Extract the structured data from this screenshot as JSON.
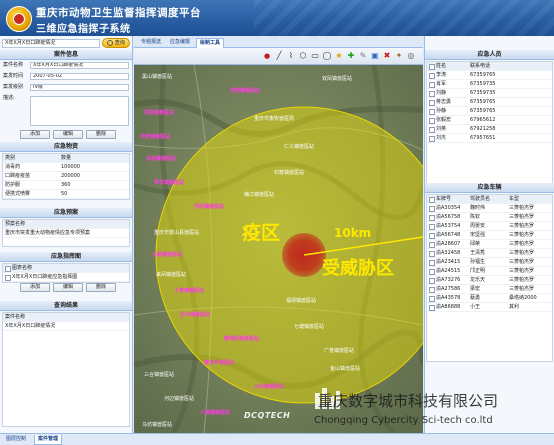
{
  "header": {
    "title_line1": "重庆市动物卫生监督指挥调度平台",
    "title_line2": "三维应急指挥子系统"
  },
  "left": {
    "search": {
      "value": "X年X月X日口蹄疫情况",
      "button": "查询"
    },
    "case_info": {
      "title": "案件信息",
      "fields": [
        {
          "label": "案件名称",
          "value": "X年X月X日口蹄疫情况"
        },
        {
          "label": "案发时间",
          "value": "2007-05-02"
        },
        {
          "label": "案发级别",
          "value": "IV级"
        },
        {
          "label": "描述:",
          "value": ""
        }
      ],
      "buttons": [
        "添加",
        "编辑",
        "删除"
      ]
    },
    "supplies": {
      "title": "应急物资",
      "headers": [
        "类别",
        "数量"
      ],
      "rows": [
        {
          "name": "消毒药",
          "qty": "100000"
        },
        {
          "name": "口蹄疫疫苗",
          "qty": "200000"
        },
        {
          "name": "防护服",
          "qty": "360"
        },
        {
          "name": "便携式喷雾",
          "qty": "50"
        }
      ]
    },
    "plan": {
      "title": "应急预案",
      "header": "预案名称",
      "rows": [
        "重庆市突发重大动物疫情应急专项预案"
      ]
    },
    "plan_map": {
      "title": "应急指挥图",
      "header": "图表名称",
      "rows": [
        "X年X月X日口蹄疫应急指挥图"
      ],
      "buttons": [
        "添加",
        "编辑",
        "删除"
      ]
    },
    "results": {
      "title": "查询结果",
      "header": "案件名称",
      "rows": [
        "X年X月X日口蹄疫情况"
      ]
    }
  },
  "center": {
    "tabs": [
      "专题报送",
      "应急编报",
      "绘制工具"
    ],
    "active_tab": 2,
    "map": {
      "label_epidemic": "疫区",
      "label_radius": "10km",
      "label_threat": "受威胁区",
      "places": [
        "黑山镇兽医站",
        "龙岗镇兽医站",
        "双凤镇兽医站",
        "花园镇兽医站",
        "重庆市畜牧兽医局",
        "天府镇兽医站",
        "仁义镇兽医站",
        "白庙镇兽医站",
        "石鞋镇兽医站",
        "青杠镇兽医站",
        "梅江镇兽医站",
        "丹阳镇兽医站",
        "重庆市璧山县兽医站",
        "大路镇兽医站",
        "来凤镇兽医站",
        "丁家镇兽医站",
        "福禄镇兽医站",
        "正兴镇兽医站",
        "七塘镇兽医站",
        "璧城街道兽医站",
        "广普镇兽医站",
        "健龙乡兽医站",
        "三合镇兽医站",
        "大兴镇兽医站",
        "河边镇兽医站",
        "八塘镇兽医站",
        "金山镇兽医站",
        "马坊镇兽医站"
      ]
    }
  },
  "right": {
    "personnel": {
      "title": "应急人员",
      "headers": [
        "姓名",
        "联系电话"
      ],
      "rows": [
        [
          "李涛",
          "67359765"
        ],
        [
          "肖军",
          "67359735"
        ],
        [
          "刘静",
          "67359735"
        ],
        [
          "蒋志勇",
          "67359765"
        ],
        [
          "孙静",
          "67359765"
        ],
        [
          "张毅宏",
          "67965612"
        ],
        [
          "刘英",
          "67921258"
        ],
        [
          "刘杰",
          "67957651"
        ]
      ]
    },
    "vehicles": {
      "title": "应急车辆",
      "headers": [
        "车牌号",
        "驾驶员名",
        "车型"
      ],
      "rows": [
        [
          "渝A30354",
          "魏时伟",
          "三菱帕杰罗"
        ],
        [
          "渝A56758",
          "陈钦",
          "三菱帕杰罗"
        ],
        [
          "渝A53754",
          "周晏安",
          "三菱帕杰罗"
        ],
        [
          "渝A56748",
          "宋坚强",
          "三菱帕杰罗"
        ],
        [
          "渝A28607",
          "邱荣",
          "三菱帕杰罗"
        ],
        [
          "渝A32458",
          "王清秀",
          "三菱帕杰罗"
        ],
        [
          "渝A23415",
          "孙福生",
          "三菱帕杰罗"
        ],
        [
          "渝A24515",
          "邝正明",
          "三菱帕杰罗"
        ],
        [
          "渝A73276",
          "龙乐天",
          "三菱帕杰罗"
        ],
        [
          "渝A27586",
          "梁宏",
          "三菱帕杰罗"
        ],
        [
          "渝A43578",
          "蔡勇",
          "桑塔纳2000"
        ],
        [
          "渝A86888",
          "小王",
          "其利"
        ]
      ]
    }
  },
  "status_tabs": [
    "图层控制",
    "案件管理"
  ],
  "active_status_tab": 1,
  "watermark": {
    "cn": "重庆数字城市科技有限公司",
    "en": "Chongqing Cybercity Sci-tech co.ltd",
    "logo": "DCQTECH"
  },
  "colors": {
    "header_blue": "#2a5fa3",
    "epidemic_red": "#d62a1c",
    "threat_yellow": "#f2e400",
    "place_pink": "#ff3de0"
  }
}
